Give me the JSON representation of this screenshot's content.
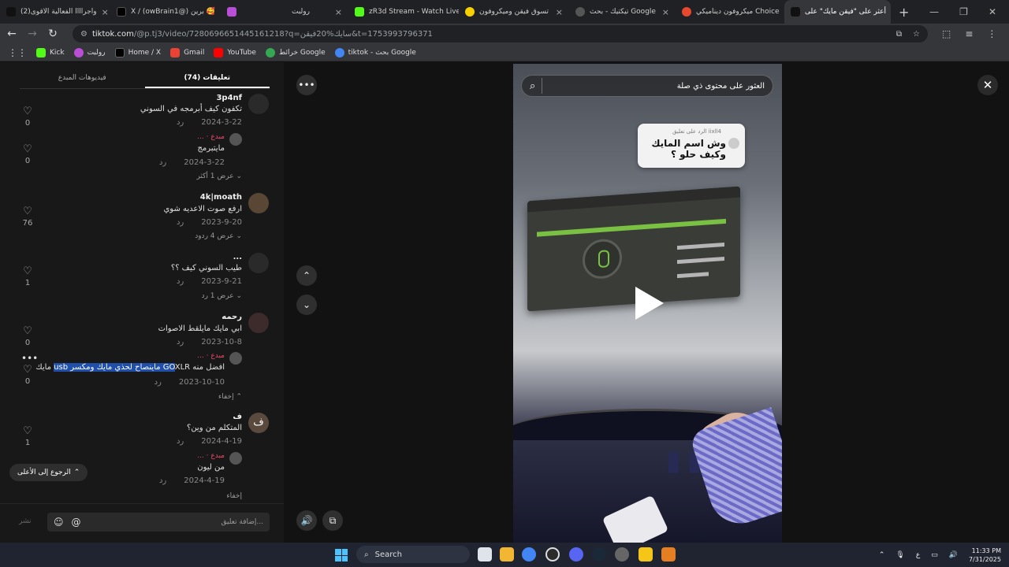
{
  "browser": {
    "tabs": [
      {
        "title": "(2)واجراااا الفعالية الاقوى",
        "color": "#111111",
        "active": false
      },
      {
        "title": "X / (owBrain1@) برين 🥰",
        "color": "#000000",
        "active": false
      },
      {
        "title": "",
        "color": "#b84fd6",
        "active": false
      },
      {
        "title": "رولبت",
        "color": "#2a2a2a",
        "active": false
      },
      {
        "title": "zR3d Stream - Watch Live",
        "color": "#53fc18",
        "active": false
      },
      {
        "title": "تسوق فيقن وميكروفون",
        "color": "#f7d100",
        "active": false
      },
      {
        "title": "تيكتيك - بحث Google",
        "color": "#4a4a4a",
        "active": false
      },
      {
        "title": "ميكروفون ديناميكي Choice",
        "color": "#e8482e",
        "active": false
      },
      {
        "title": "أعثر على \"فيقن مايك\" على",
        "color": "#111111",
        "active": true
      }
    ],
    "new_tab": "+",
    "url_host": "tiktok.com",
    "url_path": "/@p.tj3/video/7280696651445161218?q=سايك%20فيقن&t=1753993796371",
    "bookmarks": [
      {
        "label": "Kick",
        "color": "#53fc18"
      },
      {
        "label": "رولبت",
        "color": "#b84fd6"
      },
      {
        "label": "Home / X",
        "color": "#000000"
      },
      {
        "label": "Gmail",
        "color": "#ea4335"
      },
      {
        "label": "YouTube",
        "color": "#ff0000"
      },
      {
        "label": "خرائط Google",
        "color": "#34a853"
      },
      {
        "label": "tiktok - بحث Google",
        "color": "#4285f4"
      }
    ]
  },
  "comments_panel": {
    "tab_creator": "فيديوهات المبدع",
    "tab_comments": "(74) تعليقات",
    "reply_label": "رد",
    "creator_badge": "مبدع",
    "comments": [
      {
        "user": "3p4nf",
        "text": "تكفون كيف أبرمجه في السوني",
        "date": "2024-3-22",
        "likes": "0",
        "reply": {
          "user": "...",
          "text": "مايتبرمج",
          "date": "2024-3-22",
          "likes": "0"
        },
        "more": "عرض 1 أكثر"
      },
      {
        "user": "4k|moath",
        "text": "ارفع صوت الاعديه شوي",
        "date": "2023-9-20",
        "likes": "76",
        "more": "عرض 4 ردود"
      },
      {
        "user": "...",
        "text": "طيب السوني كيف ؟؟",
        "date": "2023-9-21",
        "likes": "1",
        "more": "عرض 1 رد"
      },
      {
        "user": "رحمه",
        "text": "ابي مايك مايلقط الاصوات",
        "date": "2023-10-8",
        "likes": "0",
        "reply": {
          "user": "...",
          "text_before": "مايك ",
          "text_hl": "usb ماينصاح لحذي مايك ومكسر GO",
          "text_after": "XLR افضل منه",
          "date": "2023-10-10",
          "likes": "0"
        },
        "more": "إخفاء"
      },
      {
        "user": "ف",
        "text": "المتكلم من وين؟",
        "date": "2024-4-19",
        "likes": "1",
        "reply": {
          "user": "...",
          "text": "من ليون",
          "date": "2024-4-19",
          "likes": ""
        },
        "more": "إخفاء"
      }
    ],
    "go_top": "الرجوع إلى الأعلى",
    "input_placeholder": "إضافة تعليق...",
    "post_label": "نشر"
  },
  "video": {
    "search_text": "العثور على محتوى ذي صلة",
    "reply_to": "الرد على تعليق iixll4",
    "bubble_text": "وش اسم المايك وكيف حلو ؟"
  },
  "taskbar": {
    "search_label": "Search",
    "lang": "ع",
    "time": "11:33 PM",
    "date": "7/31/2025"
  }
}
